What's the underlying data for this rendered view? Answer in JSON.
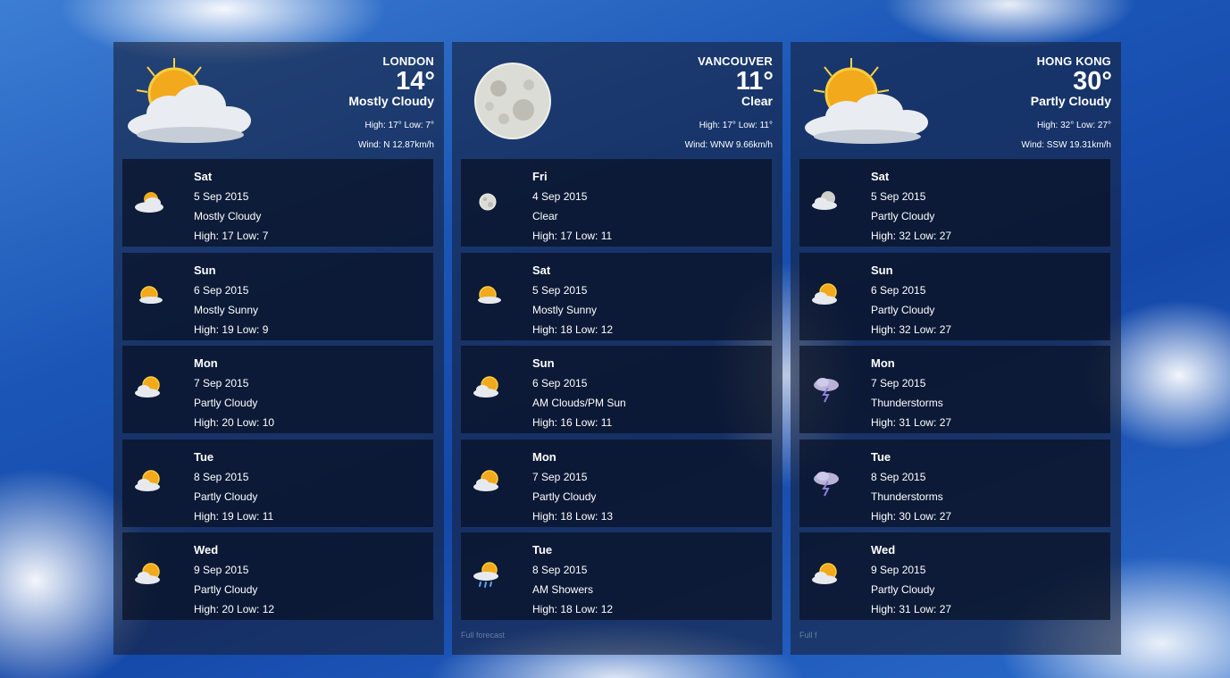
{
  "cities": [
    {
      "name": "LONDON",
      "temp": "14°",
      "condition": "Mostly Cloudy",
      "hilo": "High: 17° Low: 7°",
      "wind": "Wind: N 12.87km/h",
      "icon": "mostly-cloudy-icon",
      "days": [
        {
          "day": "Sat",
          "date": "5 Sep 2015",
          "cond": "Mostly Cloudy",
          "hilo": "High: 17 Low: 7",
          "icon": "mostly-cloudy-icon"
        },
        {
          "day": "Sun",
          "date": "6 Sep 2015",
          "cond": "Mostly Sunny",
          "hilo": "High: 19 Low: 9",
          "icon": "mostly-sunny-icon"
        },
        {
          "day": "Mon",
          "date": "7 Sep 2015",
          "cond": "Partly Cloudy",
          "hilo": "High: 20 Low: 10",
          "icon": "partly-cloudy-icon"
        },
        {
          "day": "Tue",
          "date": "8 Sep 2015",
          "cond": "Partly Cloudy",
          "hilo": "High: 19 Low: 11",
          "icon": "partly-cloudy-icon"
        },
        {
          "day": "Wed",
          "date": "9 Sep 2015",
          "cond": "Partly Cloudy",
          "hilo": "High: 20 Low: 12",
          "icon": "partly-cloudy-icon"
        }
      ],
      "footer": ""
    },
    {
      "name": "VANCOUVER",
      "temp": "11°",
      "condition": "Clear",
      "hilo": "High: 17° Low: 11°",
      "wind": "Wind: WNW 9.66km/h",
      "icon": "moon-icon",
      "days": [
        {
          "day": "Fri",
          "date": "4 Sep 2015",
          "cond": "Clear",
          "hilo": "High: 17 Low: 11",
          "icon": "moon-icon"
        },
        {
          "day": "Sat",
          "date": "5 Sep 2015",
          "cond": "Mostly Sunny",
          "hilo": "High: 18 Low: 12",
          "icon": "mostly-sunny-icon"
        },
        {
          "day": "Sun",
          "date": "6 Sep 2015",
          "cond": "AM Clouds/PM Sun",
          "hilo": "High: 16 Low: 11",
          "icon": "partly-cloudy-icon"
        },
        {
          "day": "Mon",
          "date": "7 Sep 2015",
          "cond": "Partly Cloudy",
          "hilo": "High: 18 Low: 13",
          "icon": "partly-cloudy-icon"
        },
        {
          "day": "Tue",
          "date": "8 Sep 2015",
          "cond": "AM Showers",
          "hilo": "High: 18 Low: 12",
          "icon": "showers-icon"
        }
      ],
      "footer": "Full forecast"
    },
    {
      "name": "HONG KONG",
      "temp": "30°",
      "condition": "Partly Cloudy",
      "hilo": "High: 32° Low: 27°",
      "wind": "Wind: SSW 19.31km/h",
      "icon": "partly-cloudy-icon",
      "days": [
        {
          "day": "Sat",
          "date": "5 Sep 2015",
          "cond": "Partly Cloudy",
          "hilo": "High: 32 Low: 27",
          "icon": "partly-cloudy-night-icon"
        },
        {
          "day": "Sun",
          "date": "6 Sep 2015",
          "cond": "Partly Cloudy",
          "hilo": "High: 32 Low: 27",
          "icon": "partly-cloudy-icon"
        },
        {
          "day": "Mon",
          "date": "7 Sep 2015",
          "cond": "Thunderstorms",
          "hilo": "High: 31 Low: 27",
          "icon": "thunderstorm-icon"
        },
        {
          "day": "Tue",
          "date": "8 Sep 2015",
          "cond": "Thunderstorms",
          "hilo": "High: 30 Low: 27",
          "icon": "thunderstorm-icon"
        },
        {
          "day": "Wed",
          "date": "9 Sep 2015",
          "cond": "Partly Cloudy",
          "hilo": "High: 31 Low: 27",
          "icon": "partly-cloudy-icon"
        }
      ],
      "footer": "Full f"
    }
  ]
}
